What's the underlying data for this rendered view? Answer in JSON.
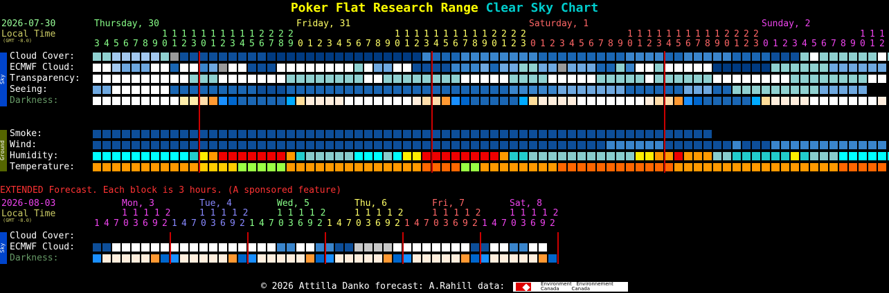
{
  "title": {
    "part1": "Poker Flat Research Range",
    "part2": "Clear Sky Chart"
  },
  "main": {
    "date": "2026-07-30",
    "local_time": "Local Time",
    "gmt": "(GMT -8.0)",
    "days": [
      {
        "label": "Thursday, 30",
        "color": "#8f8"
      },
      {
        "label": "Friday, 31",
        "color": "#ff6"
      },
      {
        "label": "Saturday, 1",
        "color": "#f66"
      },
      {
        "label": "Sunday, 2",
        "color": "#e4e"
      }
    ],
    "hours_top": "1 1 1 1 1 1 1 1 2 2 2 2                         1 1 1 1 1 1 1 1 1 1 1 2 2 2 2                         1 1 1 1 1 1 1 1 1 1 1 2 2 2 2                         1 1 1 1 1 1 1 1 1 1 1 1 2 2 2",
    "hours_bottom": "345678901230123456789012345678901234567890123012345678901234567890123012345678901234567890123012345678901234567890123456789012",
    "sky_tag": "Sky",
    "ground_tag": "Ground",
    "rows": {
      "cloud": "Cloud Cover:",
      "ecmwf": "ECMWF Cloud:",
      "transparency": "Transparency:",
      "seeing": "Seeing:",
      "darkness": "Darkness:",
      "smoke": "Smoke:",
      "wind": "Wind:",
      "humidity": "Humidity:",
      "temperature": "Temperature:"
    }
  },
  "extended": {
    "notice": "EXTENDED Forecast. Each block is 3 hours. (A sponsored feature)",
    "date": "2026-08-03",
    "local_time": "Local Time",
    "gmt": "(GMT -8.0)",
    "days": [
      {
        "label": "Mon, 3",
        "color": "#e4e"
      },
      {
        "label": "Tue, 4",
        "color": "#88f"
      },
      {
        "label": "Wed, 5",
        "color": "#8f8"
      },
      {
        "label": "Thu, 6",
        "color": "#ff6"
      },
      {
        "label": "Fri, 7",
        "color": "#f66"
      },
      {
        "label": "Sat, 8",
        "color": "#e4e"
      }
    ],
    "tens": "1 1 1 1 2",
    "hours": "14703692",
    "rows": {
      "cloud": "Cloud Cover:",
      "ecmwf": "ECMWF Cloud:",
      "darkness": "Darkness:"
    }
  },
  "footer": {
    "text": "© 2026 Attilla Danko  forecast: A.Rahill  data:",
    "logo_line1": "Environment   Environnement",
    "logo_line2": "Canada        Canada"
  },
  "colors": {
    "title1": "#ffff00",
    "title2": "#00cccc",
    "date": "#99ff99",
    "local": "#cccc66",
    "notice": "#ff3333",
    "darkness_label": "#669966",
    "sky_tag_bg": "#0044cc",
    "ground_tag_bg": "#556b00",
    "midnight_line": "#cc0000"
  }
}
